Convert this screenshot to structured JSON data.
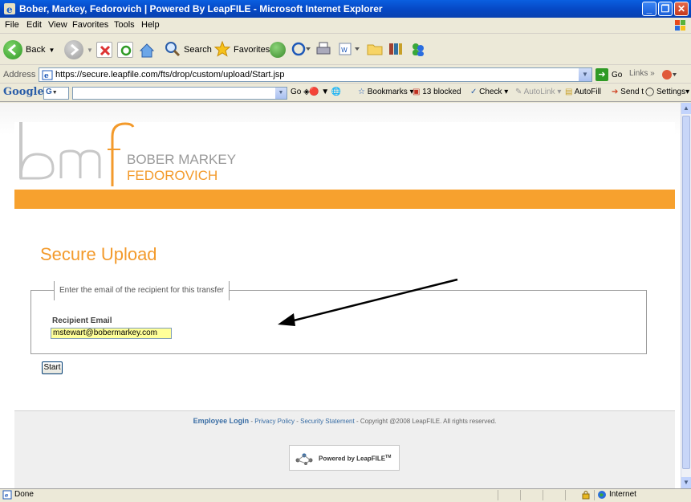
{
  "window": {
    "title": "Bober, Markey, Fedorovich | Powered By LeapFILE - Microsoft Internet Explorer"
  },
  "menu": [
    "File",
    "Edit",
    "View",
    "Favorites",
    "Tools",
    "Help"
  ],
  "toolbar": {
    "back": "Back",
    "search": "Search",
    "favorites": "Favorites"
  },
  "address": {
    "label": "Address",
    "url": "https://secure.leapfile.com/fts/drop/custom/upload/Start.jsp",
    "go": "Go",
    "links": "Links"
  },
  "google_bar": {
    "logo": "Google",
    "g_box": "G",
    "go": "Go",
    "bookmarks": "Bookmarks",
    "blocked": "13 blocked",
    "check": "Check",
    "autolink": "AutoLink",
    "autofill": "AutoFill",
    "sendto": "Send to",
    "settings": "Settings"
  },
  "brand": {
    "line1": "BOBER MARKEY",
    "line2": "FEDOROVICH",
    "monogram": "bmf"
  },
  "page": {
    "heading": "Secure Upload",
    "legend": "Enter the email of the recipient for this transfer",
    "field_label": "Recipient Email",
    "email_value": "mstewart@bobermarkey.com",
    "start_button": "Start"
  },
  "footer": {
    "employee_login": "Employee Login",
    "sep": " - ",
    "privacy": "Privacy Policy",
    "security": "Security Statement",
    "copyright": "Copyright @2008 LeapFILE. All rights reserved.",
    "powered": "Powered by LeapFILE",
    "tm": "TM"
  },
  "status": {
    "left": "Done",
    "zone": "Internet"
  }
}
